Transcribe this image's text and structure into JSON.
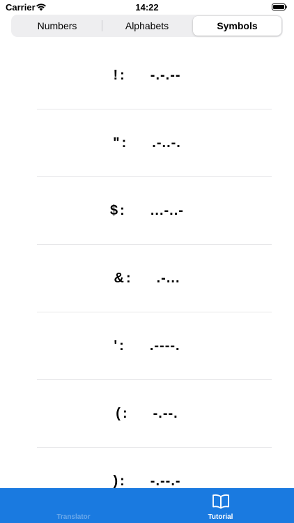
{
  "status_bar": {
    "carrier": "Carrier",
    "time": "14:22"
  },
  "segmented_control": {
    "options": [
      "Numbers",
      "Alphabets",
      "Symbols"
    ],
    "selected": "Symbols"
  },
  "symbols": [
    {
      "symbol": "!",
      "code": "-.-.--"
    },
    {
      "symbol": "\"",
      "code": ".-..-."
    },
    {
      "symbol": "$",
      "code": "...-..-"
    },
    {
      "symbol": "&",
      "code": ".-..."
    },
    {
      "symbol": "'",
      "code": ".----."
    },
    {
      "symbol": "(",
      "code": "-.--."
    },
    {
      "symbol": ")",
      "code": "-.--.-"
    }
  ],
  "tab_bar": {
    "background": "#1a7ae0",
    "tabs": [
      {
        "label": "Translator",
        "icon": "translator-icon",
        "active": false
      },
      {
        "label": "Tutorial",
        "icon": "book-icon",
        "active": true
      }
    ]
  }
}
